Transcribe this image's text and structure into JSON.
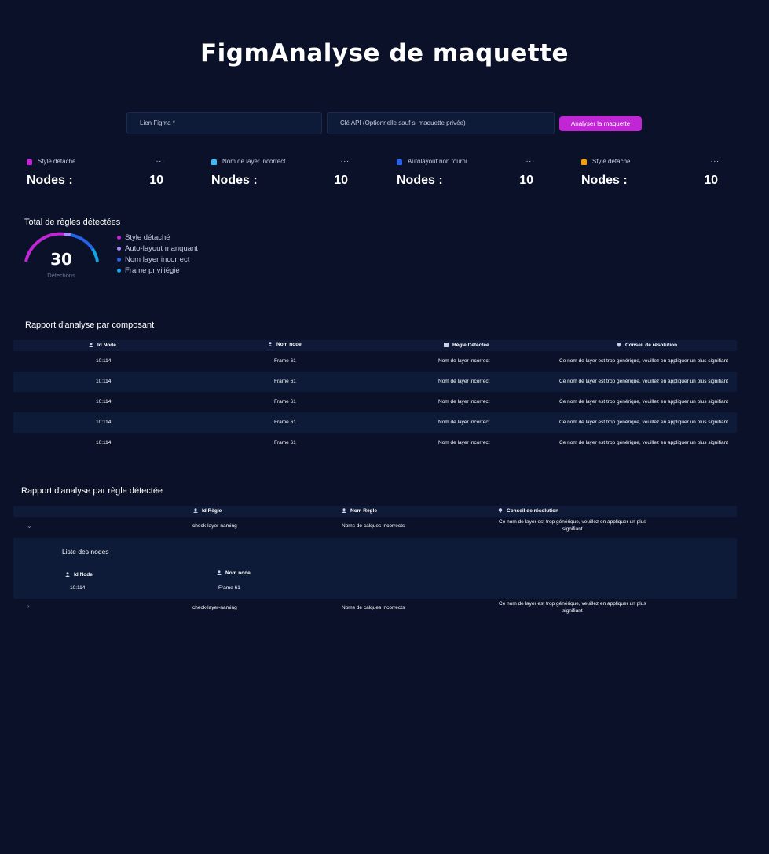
{
  "title": "FigmAnalyse de maquette",
  "form": {
    "figma_link_placeholder": "Lien Figma  *",
    "api_key_placeholder": "Clé API (Optionnelle sauf si maquette privée)",
    "submit_label": "Analyser la maquette"
  },
  "cards": [
    {
      "label": "Style détaché",
      "nodes_label": "Nodes :",
      "value": "10",
      "color": "#c026d3"
    },
    {
      "label": "Nom de layer incorrect",
      "nodes_label": "Nodes :",
      "value": "10",
      "color": "#38bdf8"
    },
    {
      "label": "Autolayout non fourni",
      "nodes_label": "Nodes :",
      "value": "10",
      "color": "#2563eb"
    },
    {
      "label": "Style détaché",
      "nodes_label": "Nodes :",
      "value": "10",
      "color": "#f59e0b"
    }
  ],
  "card_menu": "...",
  "summary": {
    "title": "Total de règles détectées",
    "count": "30",
    "count_label": "Détections",
    "legend": [
      {
        "label": "Style détaché",
        "color": "#c026d3"
      },
      {
        "label": "Auto-layout manquant",
        "color": "#a78bfa"
      },
      {
        "label": "Nom layer incorrect",
        "color": "#2563eb"
      },
      {
        "label": "Frame priviliégié",
        "color": "#0ea5e9"
      }
    ]
  },
  "component_report": {
    "title": "Rapport d'analyse par composant",
    "headers": [
      "Id Node",
      "Nom node",
      "Règle Détectée",
      "Conseil de résolution"
    ],
    "rows": [
      [
        "10:114",
        "Frame 61",
        "Nom de layer incorrect",
        "Ce nom de layer est trop générique, veuillez en appliquer un plus signifiant"
      ],
      [
        "10:114",
        "Frame 61",
        "Nom de layer incorrect",
        "Ce nom de layer est trop générique, veuillez en appliquer un plus signifiant"
      ],
      [
        "10:114",
        "Frame 61",
        "Nom de layer incorrect",
        "Ce nom de layer est trop générique, veuillez en appliquer un plus signifiant"
      ],
      [
        "10:114",
        "Frame 61",
        "Nom de layer incorrect",
        "Ce nom de layer est trop générique, veuillez en appliquer un plus signifiant"
      ],
      [
        "10:114",
        "Frame 61",
        "Nom de layer incorrect",
        "Ce nom de layer est trop générique, veuillez en appliquer un plus signifiant"
      ]
    ]
  },
  "rule_report": {
    "title": "Rapport d'analyse par règle détectée",
    "headers": [
      "Id Règle",
      "Nom Règle",
      "Conseil de résolution"
    ],
    "rows": [
      {
        "id": "check-layer-naming",
        "name": "Noms de calques incorrects",
        "advice_line1": "Ce nom de layer est trop générique, veuillez en appliquer un plus",
        "advice_line2": "signifiant"
      },
      {
        "id": "check-layer-naming",
        "name": "Noms de calques incorrects",
        "advice_line1": "Ce nom de layer est trop générique, veuillez en appliquer un plus",
        "advice_line2": "signifiant"
      }
    ],
    "nodes_list": {
      "title": "Liste des nodes",
      "headers": [
        "Id Node",
        "Nom node"
      ],
      "rows": [
        [
          "10:114",
          "Frame 61"
        ]
      ]
    }
  }
}
